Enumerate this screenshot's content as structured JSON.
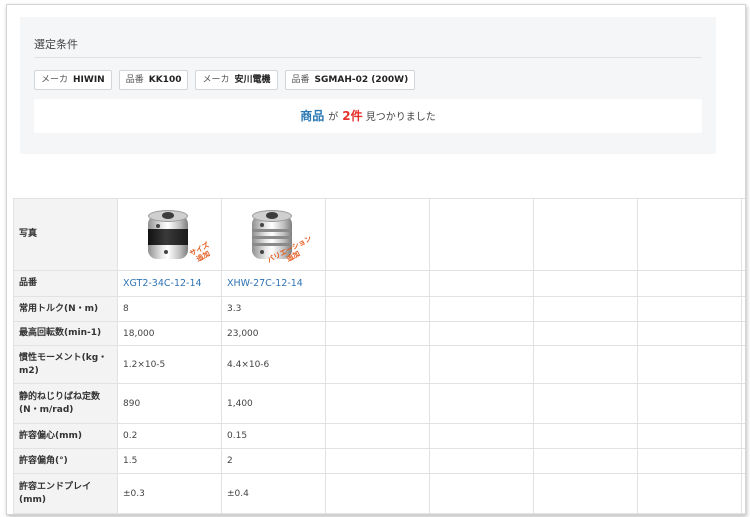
{
  "conditions": {
    "title": "選定条件",
    "tags": [
      {
        "key": "メーカ",
        "value": "HIWIN"
      },
      {
        "key": "品番",
        "value": "KK100"
      },
      {
        "key": "メーカ",
        "value": "安川電機"
      },
      {
        "key": "品番",
        "value": "SGMAH-02 (200W)"
      }
    ],
    "result": {
      "label": "商品",
      "particle": "が",
      "count": "2件",
      "suffix": "見つかりました"
    }
  },
  "colors": {
    "link": "#2f74b5",
    "count": "#e5312d",
    "label_bg": "#f3f3f3"
  },
  "products": [
    {
      "badge": [
        "サイズ",
        "追加"
      ],
      "part_no": "XGT2-34C-12-14",
      "torque": "8",
      "max_speed": "18,000",
      "inertia": "1.2×10-5",
      "torsion": "890",
      "offset": "0.2",
      "angle": "1.5",
      "endplay": "±0.3"
    },
    {
      "badge": [
        "バリエーション",
        "追加"
      ],
      "part_no": "XHW-27C-12-14",
      "torque": "3.3",
      "max_speed": "23,000",
      "inertia": "4.4×10-6",
      "torsion": "1,400",
      "offset": "0.15",
      "angle": "2",
      "endplay": "±0.4"
    }
  ],
  "labels": {
    "photo": "写真",
    "part_no": "品番",
    "torque": "常用トルク(N・m)",
    "max_speed": "最高回転数(min-1)",
    "inertia": "慣性モーメント(kg・m2)",
    "torsion": "静的ねじりばね定数(N・m/rad)",
    "offset": "許容偏心(mm)",
    "angle": "許容偏角(°)",
    "endplay": "許容エンドプレイ(mm)"
  }
}
